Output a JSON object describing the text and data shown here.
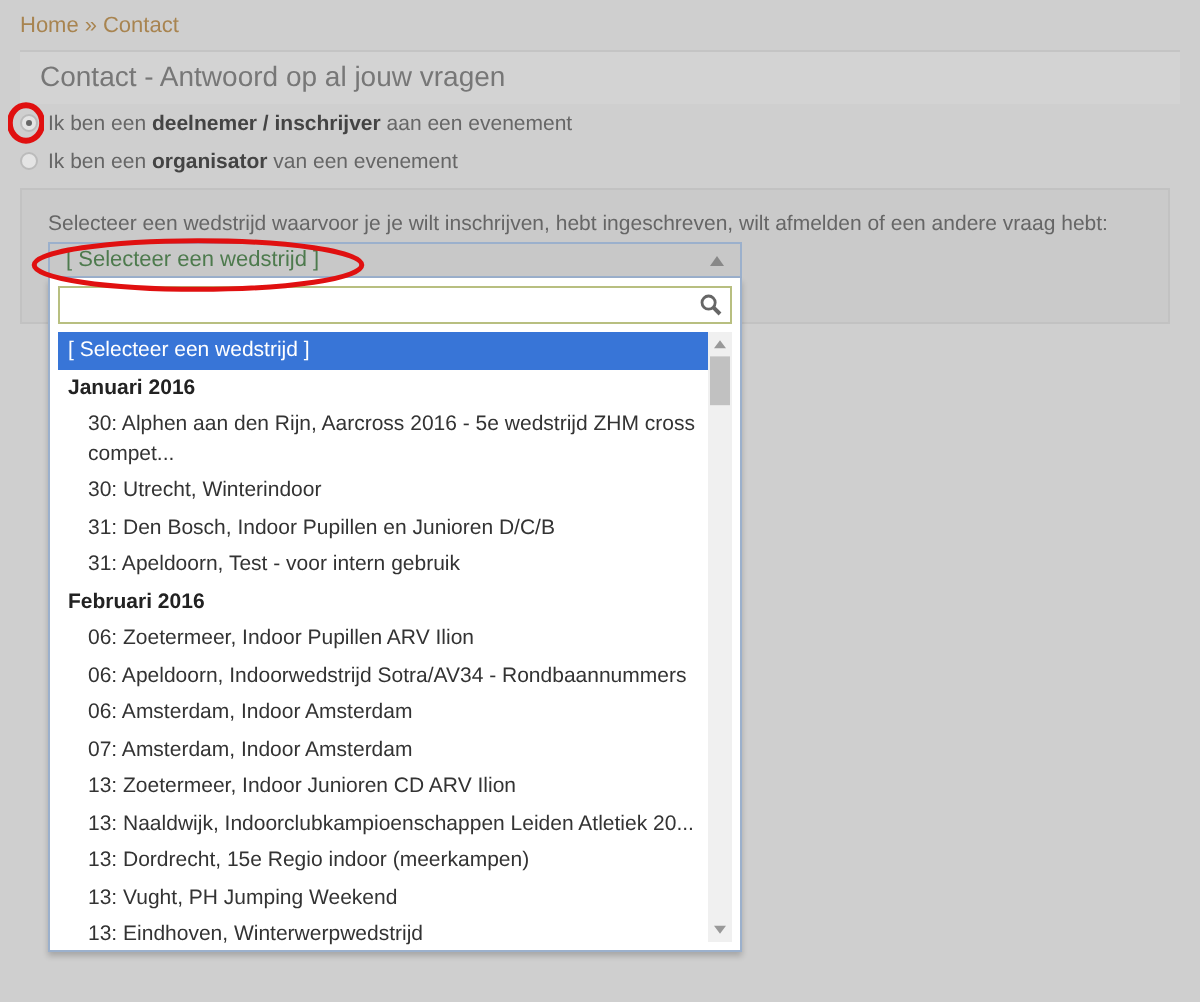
{
  "breadcrumb": {
    "items": [
      "Home",
      "Contact"
    ],
    "separator": "»"
  },
  "title": "Contact - Antwoord op al jouw vragen",
  "radios": [
    {
      "label": "Ik ben een **deelnemer / inschrijver** aan een evenement",
      "selected": true
    },
    {
      "label": "Ik ben een **organisator** van een evenement",
      "selected": false
    }
  ],
  "prompt": "Selecteer een wedstrijd waarvoor je je wilt inschrijven, hebt ingeschreven, wilt afmelden of een andere vraag hebt:",
  "select": {
    "value": "[ Selecteer een wedstrijd ]",
    "expanded": true
  },
  "options": [
    {
      "kind": "option",
      "label": "[ Selecteer een wedstrijd ]",
      "selected": true
    },
    {
      "kind": "group",
      "label": "Januari 2016",
      "children": [
        {
          "label": "30: Alphen aan den Rijn, Aarcross 2016 - 5e wedstrijd ZHM cross compet...",
          "selected": false
        },
        {
          "label": "30: Utrecht, Winterindoor",
          "selected": false
        },
        {
          "label": "31: Den Bosch, Indoor Pupillen en Junioren D/C/B",
          "selected": false
        },
        {
          "label": "31: Apeldoorn, Test - voor intern gebruik",
          "selected": false
        }
      ]
    },
    {
      "kind": "group",
      "label": "Februari 2016",
      "children": [
        {
          "label": "06: Zoetermeer, Indoor Pupillen ARV Ilion",
          "selected": false
        },
        {
          "label": "06: Apeldoorn, Indoorwedstrijd Sotra/AV34 - Rondbaannummers",
          "selected": false
        },
        {
          "label": "06: Amsterdam, Indoor Amsterdam",
          "selected": false
        },
        {
          "label": "07: Amsterdam, Indoor Amsterdam",
          "selected": false
        },
        {
          "label": "13: Zoetermeer, Indoor Junioren CD ARV Ilion",
          "selected": false
        },
        {
          "label": "13: Naaldwijk, Indoorclubkampioenschappen Leiden Atletiek 20...",
          "selected": false
        },
        {
          "label": "13: Dordrecht, 15e Regio indoor (meerkampen)",
          "selected": false
        },
        {
          "label": "13: Vught, PH Jumping Weekend",
          "selected": false
        },
        {
          "label": "13: Eindhoven, Winterwerpwedstrijd",
          "selected": false
        }
      ]
    }
  ],
  "annotations": [
    {
      "kind": "ellipse"
    },
    {
      "kind": "ellipse"
    }
  ]
}
